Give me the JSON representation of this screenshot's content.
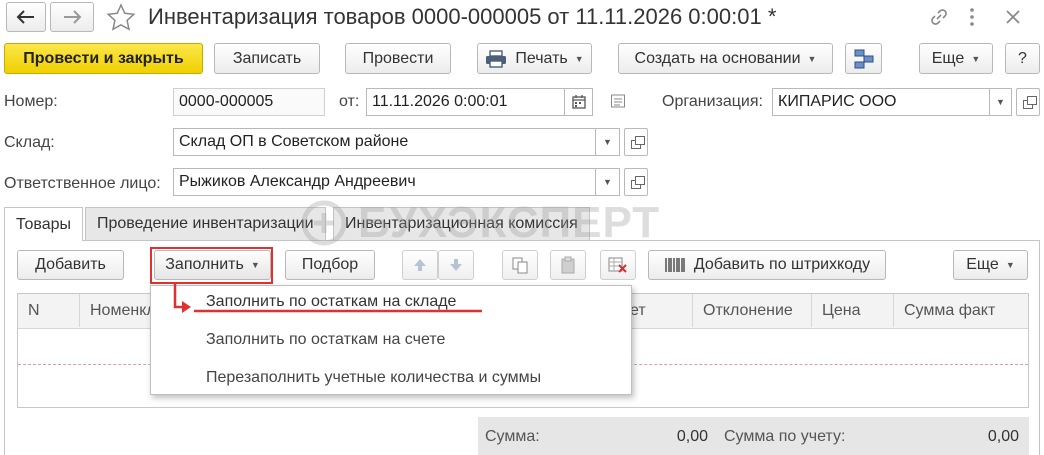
{
  "window": {
    "title": "Инвентаризация товаров 0000-000005 от 11.11.2026 0:00:01 *"
  },
  "toolbar": {
    "post_close": "Провести и закрыть",
    "save": "Записать",
    "post": "Провести",
    "print": "Печать",
    "create_based": "Создать на основании",
    "more": "Еще",
    "help": "?"
  },
  "header": {
    "number_label": "Номер:",
    "number_value": "0000-000005",
    "date_label": "от:",
    "date_value": "11.11.2026  0:00:01",
    "org_label": "Организация:",
    "org_value": "КИПАРИС ООО",
    "warehouse_label": "Склад:",
    "warehouse_value": "Склад ОП в Советском районе",
    "responsible_label": "Ответственное лицо:",
    "responsible_value": "Рыжиков Александр Андреевич"
  },
  "tabs": [
    {
      "label": "Товары",
      "active": true
    },
    {
      "label": "Проведение инвентаризации",
      "active": false
    },
    {
      "label": "Инвентаризационная комиссия",
      "active": false
    }
  ],
  "watermark": "БУХЭКСПЕРТ",
  "table_toolbar": {
    "add": "Добавить",
    "fill": "Заполнить",
    "selection": "Подбор",
    "add_barcode": "Добавить по штрихкоду",
    "more": "Еще"
  },
  "table": {
    "columns": [
      "N",
      "Номенклатура",
      "ет",
      "Отклонение",
      "Цена",
      "Сумма факт"
    ]
  },
  "fill_menu": {
    "items": [
      "Заполнить по остаткам на складе",
      "Заполнить по остаткам на счете",
      "Перезаполнить учетные количества и суммы"
    ],
    "highlighted_index": 0
  },
  "totals": {
    "sum_label": "Сумма:",
    "sum_value": "0,00",
    "sum_account_label": "Сумма по учету:",
    "sum_account_value": "0,00"
  },
  "colors": {
    "primary_button": "#f5d810",
    "annotation_red": "#e03030",
    "totals_bg": "#e6e6e6"
  }
}
